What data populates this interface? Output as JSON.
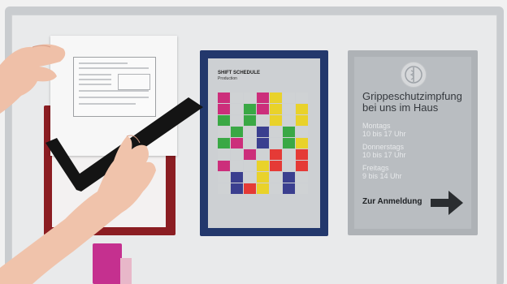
{
  "scene": "whiteboard-with-poster-frames",
  "schedule_poster": {
    "title": "SHIFT SCHEDULE",
    "subtitle": "Production",
    "grid_colors": [
      [
        "#cc2e7b",
        "#cfd2d4",
        "#cfd2d4",
        "#cc2e7b",
        "#e9d22a",
        "#cfd2d4",
        "#cfd2d4"
      ],
      [
        "#cc2e7b",
        "#cfd2d4",
        "#3aa845",
        "#cc2e7b",
        "#e9d22a",
        "#cfd2d4",
        "#e9d22a"
      ],
      [
        "#3aa845",
        "#cfd2d4",
        "#3aa845",
        "#cfd2d4",
        "#e9d22a",
        "#cfd2d4",
        "#e9d22a"
      ],
      [
        "#cfd2d4",
        "#3aa845",
        "#cfd2d4",
        "#3b3f8f",
        "#cfd2d4",
        "#3aa845",
        "#cfd2d4"
      ],
      [
        "#3aa845",
        "#cc2e7b",
        "#cfd2d4",
        "#3b3f8f",
        "#cfd2d4",
        "#3aa845",
        "#e9d22a"
      ],
      [
        "#cfd2d4",
        "#cfd2d4",
        "#cc2e7b",
        "#cfd2d4",
        "#e53a36",
        "#cfd2d4",
        "#e53a36"
      ],
      [
        "#cc2e7b",
        "#cfd2d4",
        "#cfd2d4",
        "#e9d22a",
        "#e53a36",
        "#cfd2d4",
        "#e53a36"
      ],
      [
        "#cfd2d4",
        "#3b3f8f",
        "#cfd2d4",
        "#e9d22a",
        "#cfd2d4",
        "#3b3f8f",
        "#cfd2d4"
      ],
      [
        "#cfd2d4",
        "#3b3f8f",
        "#e53a36",
        "#e9d22a",
        "#cfd2d4",
        "#3b3f8f",
        "#cfd2d4"
      ]
    ]
  },
  "flu_poster": {
    "title": "Grippeschutzimpfung bei uns im Haus",
    "lines": [
      "Montags",
      "10 bis 17 Uhr",
      "Donnerstags",
      "10 bis 17 Uhr",
      "Freitags",
      "9 bis 14 Uhr"
    ],
    "cta": "Zur Anmeldung"
  },
  "frame_colors": {
    "red": "#8b1d22",
    "blue": "#23386c",
    "silver": "#aeb2b6",
    "black": "#141414"
  }
}
